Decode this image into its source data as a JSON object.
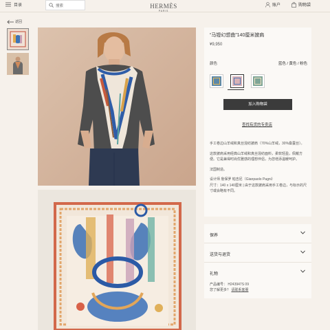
{
  "header": {
    "menu_label": "目录",
    "search_placeholder": "搜索",
    "logo_brand": "HERMÈS",
    "logo_city": "PARIS",
    "account_label": "账户",
    "cart_label": "购物袋"
  },
  "nav": {
    "back_label": "返回"
  },
  "product": {
    "title": "“马镫幻想曲”140厘米披肩",
    "price": "¥9,950",
    "color_label": "颜色",
    "color_value": "蓝色 / 黄色 / 粉色",
    "add_to_cart_label": "加入购物袋",
    "store_link_label": "查找有货的专卖店",
    "description": [
      "手工卷边山羊绒和真丝混纺披肩（70%山羊绒，30%桑蚕丝）。",
      "这款披肩采用经典山羊绒和真丝混纺面料，柔软轻盈，佩戴方便。它是兼得时尚优雅感的理想伴侣，为您增添温暖呵护。",
      "法国制造。",
      "设计师 詹保罗 帕吉尼（Gianpaolo Pagni）",
      "尺寸：140 x 140厘米 | 由于这款披肩采用手工卷边，与标示的尺寸或会略有不同。"
    ]
  },
  "accordion": {
    "items": [
      {
        "label": "保养"
      },
      {
        "label": "送货与退货"
      },
      {
        "label": "礼物"
      }
    ]
  },
  "reference": {
    "label": "产品编号：",
    "value": "H243947S 09",
    "question": "您了解更多？",
    "contact_link": "请联系客服"
  },
  "icons": [
    "menu-icon",
    "search-icon",
    "account-icon",
    "bag-icon",
    "back-arrow-icon",
    "chevron-down-icon"
  ],
  "colors": {
    "accent": "#3b3b3b",
    "background": "#f6f1eb",
    "panel": "#fbf9f6"
  }
}
